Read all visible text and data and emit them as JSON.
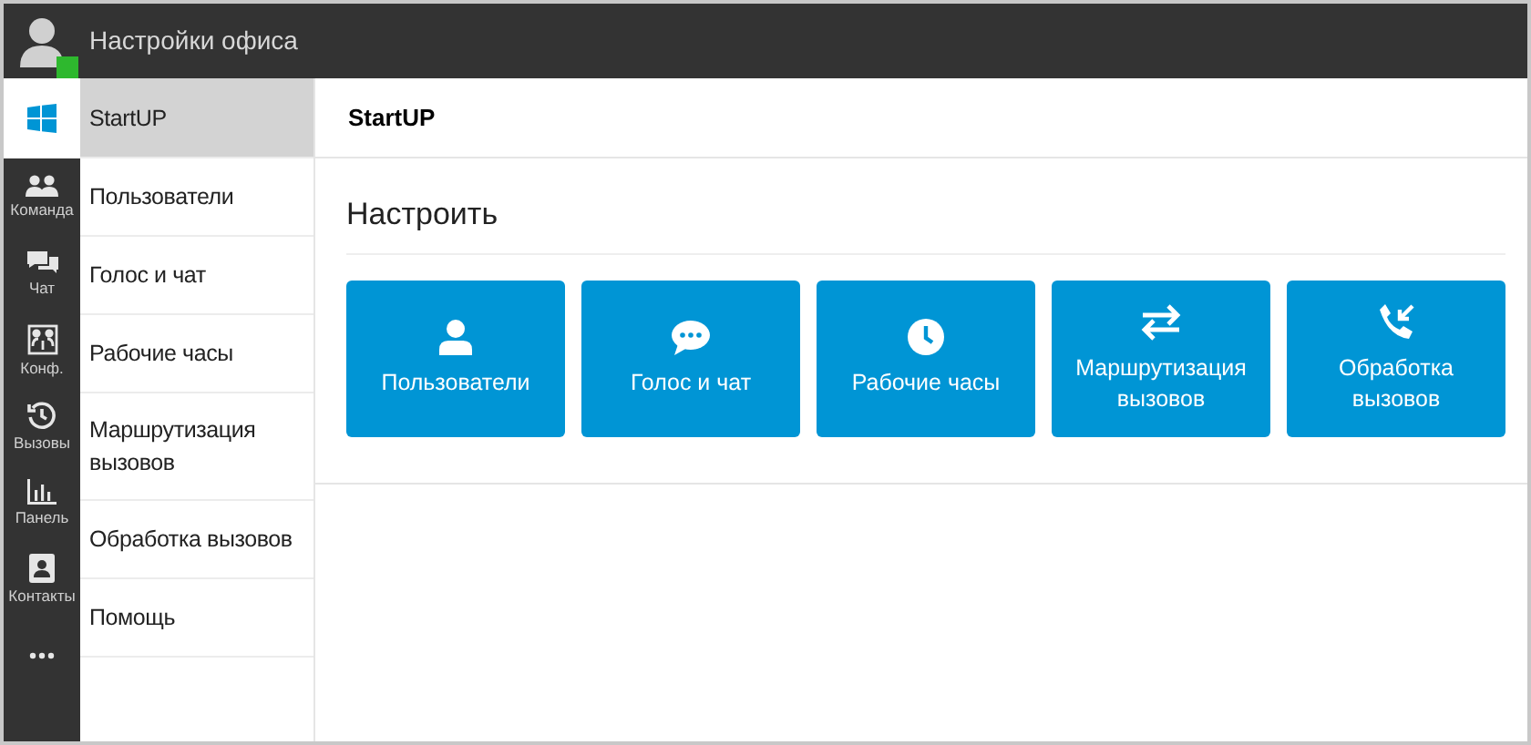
{
  "header": {
    "title": "Настройки офиса",
    "presence": {
      "color": "#2eb82e"
    }
  },
  "rail": [
    {
      "kind": "apps",
      "selected": true
    },
    {
      "kind": "team",
      "label": "Команда",
      "selected": false
    },
    {
      "kind": "chat",
      "label": "Чат",
      "selected": false
    },
    {
      "kind": "conference",
      "label": "Конф.",
      "selected": false
    },
    {
      "kind": "history",
      "label": "Вызовы",
      "selected": false
    },
    {
      "kind": "panel",
      "label": "Панель",
      "selected": false
    },
    {
      "kind": "contacts",
      "label": "Контакты",
      "selected": false
    },
    {
      "kind": "more",
      "selected": false
    }
  ],
  "menu": [
    {
      "label": "StartUP",
      "selected": true
    },
    {
      "label": "Пользователи",
      "selected": false
    },
    {
      "label": "Голос и чат",
      "selected": false
    },
    {
      "label": "Рабочие часы",
      "selected": false
    },
    {
      "label": "Маршрутизация вызовов",
      "selected": false
    },
    {
      "label": "Обработка вызовов",
      "selected": false
    },
    {
      "label": "Помощь",
      "selected": false
    }
  ],
  "page_title": "StartUP",
  "section_title": "Настроить",
  "tiles": [
    {
      "kind": "user",
      "label": "Пользователи"
    },
    {
      "kind": "chat",
      "label": "Голос и чат"
    },
    {
      "kind": "clock",
      "label": "Рабочие часы"
    },
    {
      "kind": "transfer",
      "label": "Маршрутизация вызовов"
    },
    {
      "kind": "incoming",
      "label": "Обработка вызовов"
    }
  ]
}
